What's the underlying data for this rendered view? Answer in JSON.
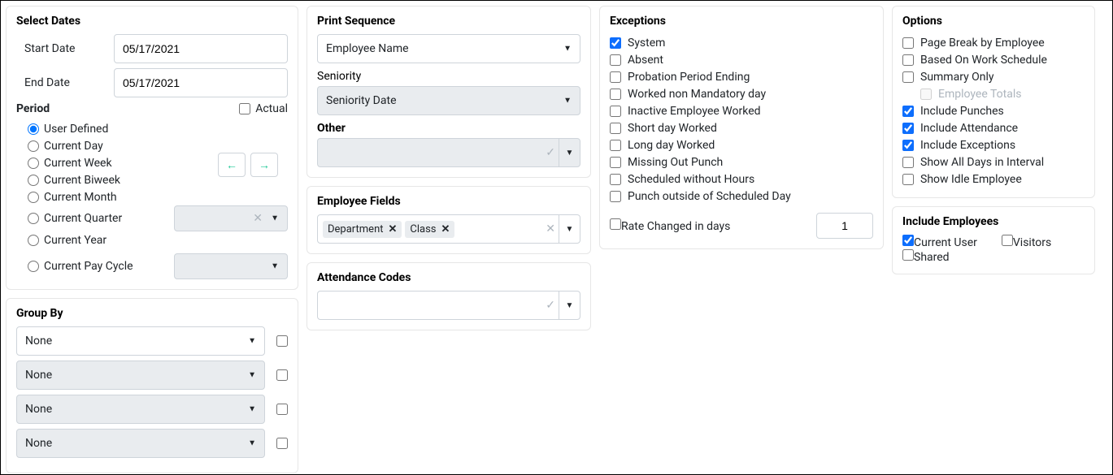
{
  "selectDates": {
    "title": "Select Dates",
    "startLabel": "Start Date",
    "startValue": "05/17/2021",
    "endLabel": "End Date",
    "endValue": "05/17/2021"
  },
  "period": {
    "title": "Period",
    "actualLabel": "Actual",
    "options": {
      "userDefined": "User Defined",
      "currentDay": "Current Day",
      "currentWeek": "Current Week",
      "currentBiweek": "Current Biweek",
      "currentMonth": "Current Month",
      "currentQuarter": "Current Quarter",
      "currentYear": "Current Year",
      "currentPayCycle": "Current Pay Cycle"
    }
  },
  "groupBy": {
    "title": "Group By",
    "none": "None"
  },
  "printSeq": {
    "title": "Print Sequence",
    "value": "Employee Name",
    "seniorityLabel": "Seniority",
    "seniorityValue": "Seniority Date",
    "otherLabel": "Other"
  },
  "employeeFields": {
    "title": "Employee Fields",
    "tags": {
      "department": "Department",
      "class": "Class"
    }
  },
  "attendanceCodes": {
    "title": "Attendance Codes"
  },
  "exceptions": {
    "title": "Exceptions",
    "items": {
      "system": "System",
      "absent": "Absent",
      "probation": "Probation Period Ending",
      "workedNonMand": "Worked non Mandatory day",
      "inactiveWorked": "Inactive Employee Worked",
      "shortDay": "Short day Worked",
      "longDay": "Long day Worked",
      "missingOut": "Missing Out Punch",
      "schedNoHours": "Scheduled without Hours",
      "punchOutside": "Punch outside of Scheduled Day"
    },
    "rateLabel": "Rate Changed in days",
    "rateValue": "1"
  },
  "options": {
    "title": "Options",
    "items": {
      "pageBreak": "Page Break by Employee",
      "basedOnWork": "Based On Work Schedule",
      "summaryOnly": "Summary Only",
      "employeeTotals": "Employee Totals",
      "includePunches": "Include Punches",
      "includeAttendance": "Include Attendance",
      "includeExceptions": "Include Exceptions",
      "showAllDays": "Show All Days in Interval",
      "showIdle": "Show Idle Employee"
    }
  },
  "includeEmployees": {
    "title": "Include Employees",
    "currentUser": "Current User",
    "visitors": "Visitors",
    "shared": "Shared"
  }
}
